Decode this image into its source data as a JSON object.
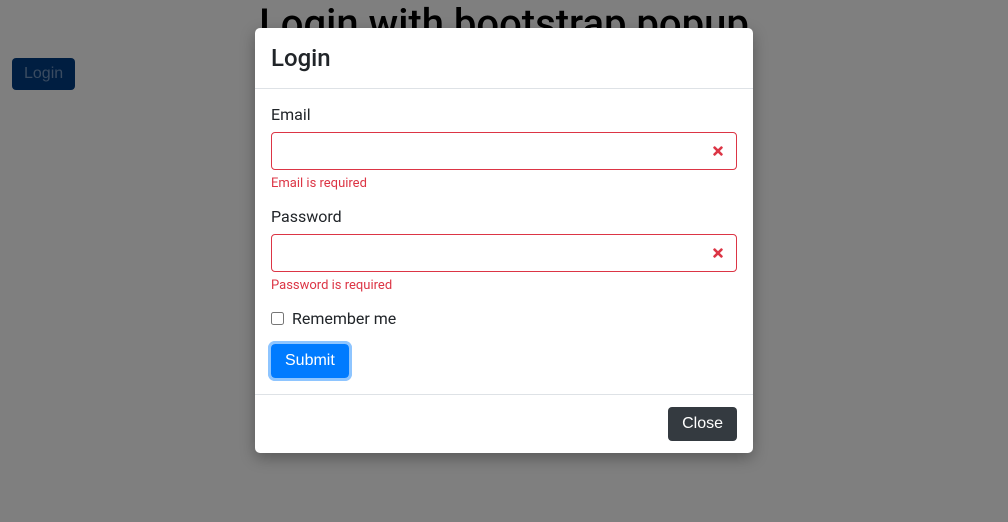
{
  "page": {
    "title": "Login with bootstrap popup"
  },
  "loginTrigger": {
    "label": "Login"
  },
  "modal": {
    "title": "Login",
    "emailLabel": "Email",
    "emailValue": "",
    "emailError": "Email is required",
    "passwordLabel": "Password",
    "passwordValue": "",
    "passwordError": "Password is required",
    "rememberLabel": "Remember me",
    "submitLabel": "Submit",
    "closeLabel": "Close",
    "colors": {
      "primary": "#007bff",
      "danger": "#dc3545",
      "dark": "#343a40"
    }
  }
}
